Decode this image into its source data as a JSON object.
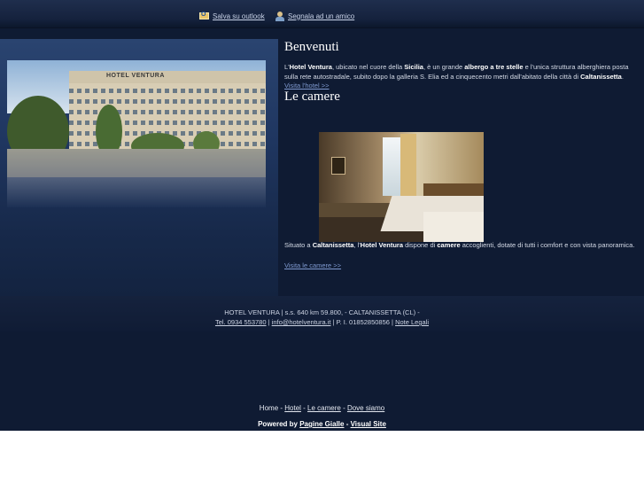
{
  "top": {
    "outlook_label": "Salva su outlook",
    "friend_label": "Segnala ad un amico"
  },
  "welcome": {
    "title": "Benvenuti",
    "p1": "L'",
    "p1_b1": "Hotel Ventura",
    "p1_t2": ", ubicato nel cuore della ",
    "p1_b2": "Sicilia",
    "p1_t3": ", è un grande ",
    "p1_b3": "albergo a tre stelle",
    "p1_t4": " e l'unica struttura alberghiera posta sulla rete autostradale, subito dopo la galleria S. Elia ed a cinquecento metri dall'abitato della città di ",
    "p1_b4": "Caltanissetta",
    "p1_t5": ".",
    "link": "Visita l'hotel >>"
  },
  "hotel_photo": {
    "sign": "HOTEL VENTURA"
  },
  "rooms": {
    "title": "Le camere",
    "p1": "Situato a ",
    "p1_b1": "Caltanissetta",
    "p1_t2": ", l'",
    "p1_b2": "Hotel Ventura",
    "p1_t3": " dispone di ",
    "p1_b3": "camere",
    "p1_t4": " accoglienti, dotate di tutti i comfort e con vista panoramica.",
    "link": "Visita le camere >>"
  },
  "footer": {
    "line1": "HOTEL VENTURA | s.s. 640 km 59.800, - CALTANISSETTA (CL) -",
    "tel": "Tel. 0934 553780",
    "sep1": " | ",
    "email": "info@hotelventura.it",
    "piva": " | P. I. 01852850856 | ",
    "legal": "Note Legali"
  },
  "nav": {
    "home": "Home",
    "sep": " - ",
    "hotel": "Hotel",
    "camere": "Le camere",
    "dove": "Dove siamo"
  },
  "powered": {
    "label": "Powered by ",
    "pg": "Pagine Gialle",
    "sep": " - ",
    "vs": "Visual Site"
  },
  "colors": {
    "background": "#0f1b33",
    "link": "#7f9ad0",
    "title": "#ffffff"
  }
}
